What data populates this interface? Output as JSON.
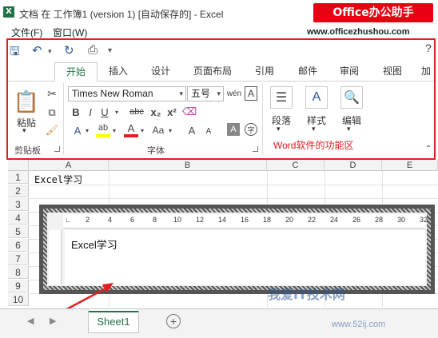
{
  "window": {
    "title": "文档 在 工作簿1 (version 1) [自动保存的] - Excel",
    "brand": "Office办公助手",
    "brand_url": "www.officezhushou.com"
  },
  "menu": [
    "文件(F)",
    "窗口(W)"
  ],
  "tabs": [
    "开始",
    "插入",
    "设计",
    "页面布局",
    "引用",
    "邮件",
    "审阅",
    "视图",
    "加"
  ],
  "ribbon": {
    "clipboard": {
      "paste_label": "粘贴",
      "group_label": "剪贴板"
    },
    "font": {
      "font_name": "Times New Roman",
      "font_size": "五号",
      "group_label": "字体",
      "buttons": [
        "B",
        "I",
        "U",
        "abc",
        "x₂",
        "x²",
        "Aa",
        "A",
        "A"
      ]
    },
    "paragraph": {
      "label": "段落"
    },
    "styles": {
      "label": "样式"
    },
    "editing": {
      "label": "编辑"
    },
    "note": "Word软件的功能区"
  },
  "sheet": {
    "columns": [
      "A",
      "B",
      "C",
      "D",
      "E"
    ],
    "rows": [
      "1",
      "2",
      "3",
      "4",
      "5",
      "6",
      "7",
      "8",
      "9",
      "10"
    ],
    "cell_a1": "Excel学习",
    "embedded_text": "Excel学习",
    "ruler_marks": [
      "2",
      "4",
      "6",
      "8",
      "10",
      "12",
      "14",
      "16",
      "18",
      "20",
      "22",
      "24",
      "26",
      "28",
      "30",
      "32"
    ]
  },
  "sheet_tabs": [
    "Sheet1"
  ],
  "watermark": "我爱IT技术网",
  "watermark_url": "www.52ij.com",
  "colors": {
    "excel_green": "#217346",
    "highlight_red": "#e02020",
    "brand_red": "#e60012"
  }
}
